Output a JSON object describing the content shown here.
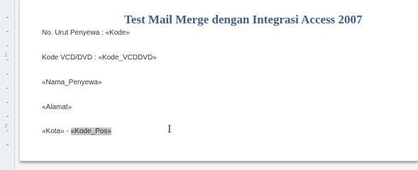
{
  "document": {
    "title": "Test Mail Merge dengan Integrasi Access 2007",
    "lines": {
      "no_urut": "No. Urut Penyewa : «Kode»",
      "kode_vcd": "Kode VCD/DVD : «Kode_VCDDVD»",
      "nama": "«Nama_Penyewa»",
      "alamat": "«Alamat»",
      "kota": "«Kota» - ",
      "kode_pos": "«Kode_Pos»"
    }
  },
  "ruler": {
    "numbers": [
      "1",
      "2"
    ]
  },
  "cursor": {
    "icon": "i-beam-cursor-icon"
  }
}
